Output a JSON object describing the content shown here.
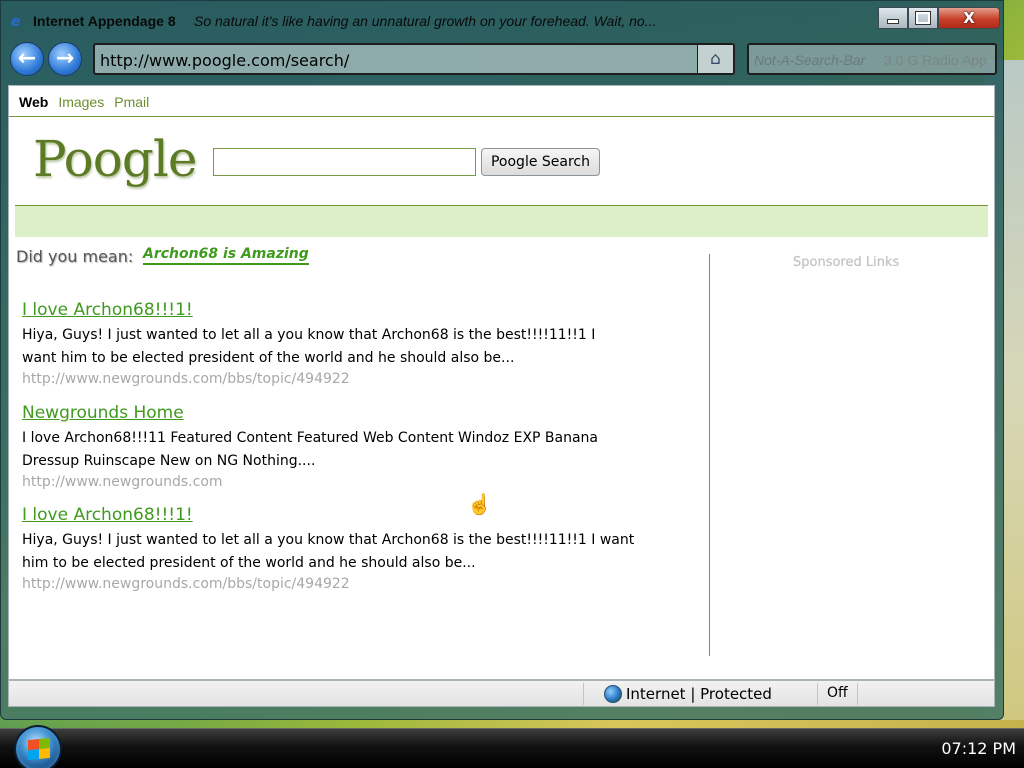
{
  "window": {
    "title": "Internet Appendage 8",
    "subtitle": "So natural it's like having an unnatural growth on your forehead.  Wait, no...",
    "controls": {
      "minimize": "",
      "maximize": "",
      "close": "X"
    }
  },
  "navbar": {
    "back_icon": "back-arrow-icon",
    "forward_icon": "forward-arrow-icon",
    "address": "http://www.poogle.com/search/",
    "home_icon": "home-icon",
    "search_box_placeholder": "Not-A-Search-Bar",
    "search_box_overlay": "3.0 G Radio App"
  },
  "page": {
    "top_links": {
      "web": "Web",
      "images": "Images",
      "mail": "Pmail"
    },
    "logo": "Poogle",
    "search_input_value": "",
    "search_button": "Poogle Search",
    "did_you_mean_label": "Did you mean:",
    "did_you_mean_link": "Archon68 is Amazing",
    "sponsored_links": "Sponsored Links",
    "results": [
      {
        "title": "I love Archon68!!!1!",
        "snippet_line1": "Hiya, Guys!   I just wanted to let all a you know that Archon68 is the best!!!!11!!1 I",
        "snippet_line2": "want him to be elected president of the world and he should also be...",
        "url": "http://www.newgrounds.com/bbs/topic/494922"
      },
      {
        "title": "Newgrounds Home",
        "snippet_line1": "I love Archon68!!!11 Featured Content Featured Web Content Windoz EXP Banana",
        "snippet_line2": "Dressup Ruinscape New on NG Nothing....",
        "url": "http://www.newgrounds.com"
      },
      {
        "title": "I love Archon68!!!1!",
        "snippet_line1": "Hiya, Guys!   I just wanted to let all a you know that Archon68 is the best!!!!11!!1 I want",
        "snippet_line2": "him to be elected president of the world and he should also be...",
        "url": "http://www.newgrounds.com/bbs/topic/494922"
      }
    ]
  },
  "statusbar": {
    "zone_icon": "globe-icon",
    "zone": "Internet | Protected",
    "toggle": "Off"
  },
  "taskbar": {
    "start_icon": "windows-logo-icon",
    "clock": "07:12 PM"
  },
  "colors": {
    "link_green": "#3f9a1e",
    "band_green": "#dcefc6",
    "rule_green": "#79943f",
    "url_gray": "#a8a8a8"
  }
}
